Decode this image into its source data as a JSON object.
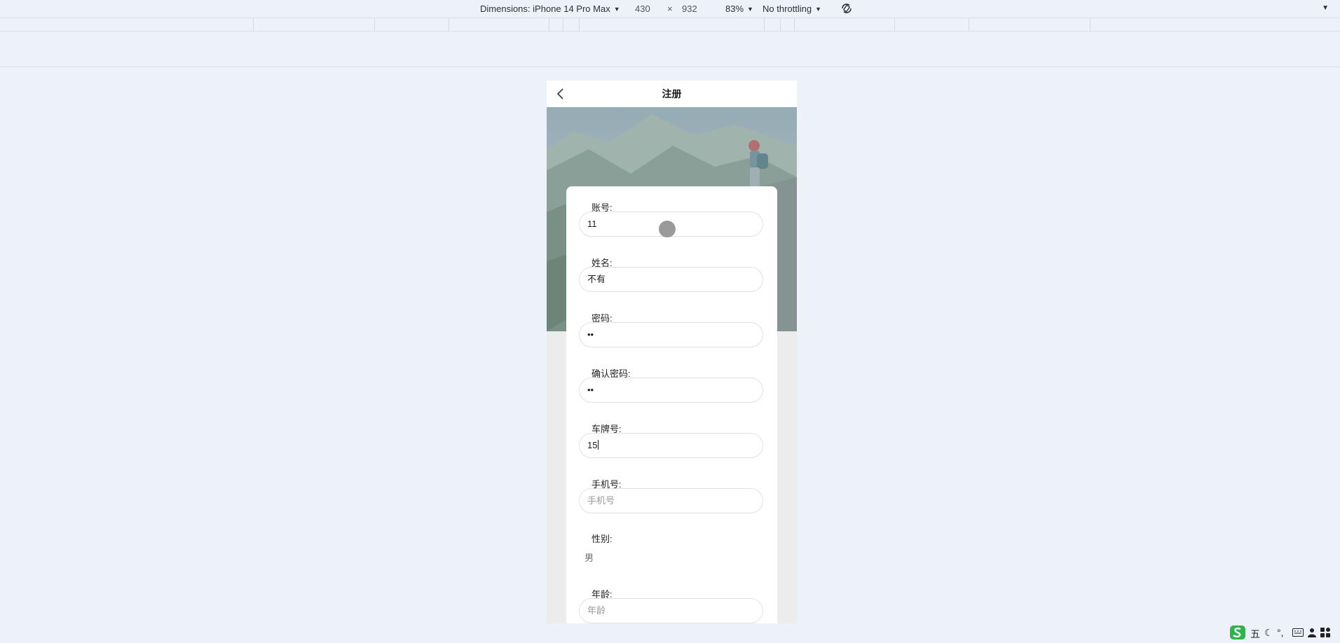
{
  "devtools": {
    "dimensions_label": "Dimensions: iPhone 14 Pro Max",
    "width": "430",
    "times": "×",
    "height": "932",
    "zoom": "83%",
    "throttling": "No throttling"
  },
  "page": {
    "title": "注册",
    "fields": [
      {
        "label": "账号:",
        "value": "11",
        "placeholder": ""
      },
      {
        "label": "姓名:",
        "value": "不有",
        "placeholder": ""
      },
      {
        "label": "密码:",
        "value": "••",
        "placeholder": ""
      },
      {
        "label": "确认密码:",
        "value": "••",
        "placeholder": ""
      },
      {
        "label": "车牌号:",
        "value": "15",
        "placeholder": ""
      },
      {
        "label": "手机号:",
        "value": "",
        "placeholder": "手机号"
      },
      {
        "label": "性别:",
        "value": "男",
        "placeholder": ""
      },
      {
        "label": "年龄:",
        "value": "",
        "placeholder": "年龄"
      }
    ]
  },
  "taskbar": {
    "ime_mode": "五"
  },
  "colors": {
    "page_bg": "#edf1fa",
    "card_bg": "#ffffff",
    "input_border": "#e1e1e1"
  }
}
